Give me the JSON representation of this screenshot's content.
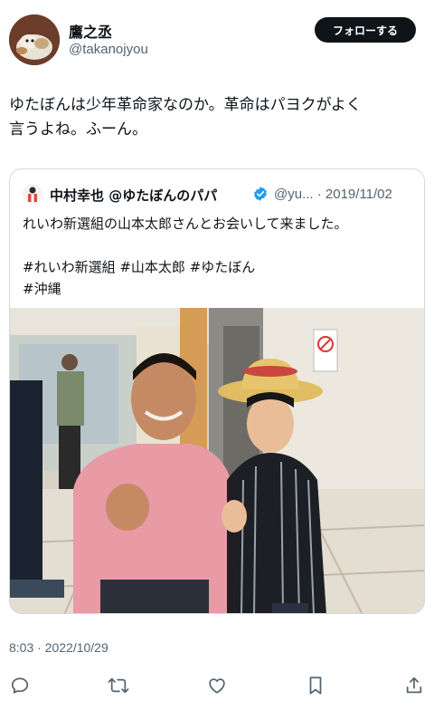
{
  "author": {
    "display_name": "鷹之丞",
    "handle": "@takanojyou",
    "avatar_icon": "cat-avatar"
  },
  "follow_button": {
    "label": "フォローする"
  },
  "tweet": {
    "text_line1": "ゆたぼんは少年革命家なのか。革命はパヨクがよく",
    "text_line2": "言うよね。ふーん。",
    "timestamp": "8:03 · 2022/10/29"
  },
  "quoted_tweet": {
    "name": "中村幸也 @ゆたぼんのパパ",
    "verified_icon": "verified-badge-icon",
    "handle_date": "@yu... · 2019/11/02",
    "text": "れいわ新選組の山本太郎さんとお会いして来ました。",
    "tags_line1": "#れいわ新選組 #山本太郎 #ゆたぼん",
    "tags_line2": "#沖縄"
  },
  "actions": [
    {
      "name": "reply-icon"
    },
    {
      "name": "retweet-icon"
    },
    {
      "name": "like-icon"
    },
    {
      "name": "bookmark-icon"
    },
    {
      "name": "share-icon"
    }
  ],
  "colors": {
    "text_primary": "#0f1419",
    "text_secondary": "#536471",
    "border": "#cfd9de",
    "verified": "#1d9bf0",
    "follow_bg": "#0f1419"
  }
}
